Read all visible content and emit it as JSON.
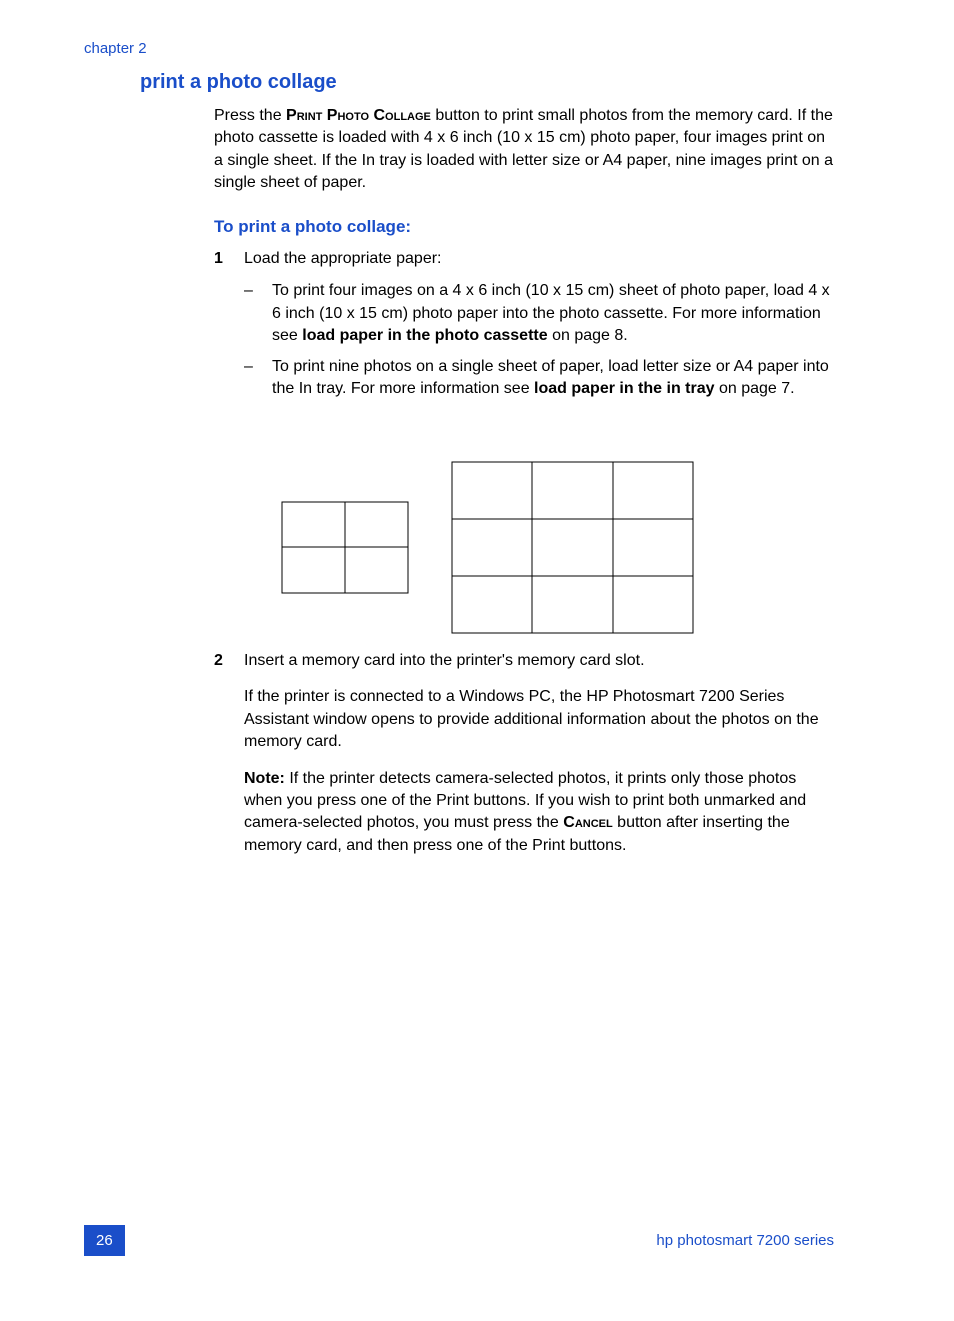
{
  "chapter": "chapter 2",
  "sectionTitle": "print a photo collage",
  "intro": {
    "pre": "Press the ",
    "btn": "Print Photo Collage",
    "post": " button to print small photos from the memory card. If the photo cassette is loaded with 4 x 6 inch (10 x 15 cm) photo paper, four images print on a single sheet. If the In tray is loaded with letter size or A4 paper, nine images print on a single sheet of paper."
  },
  "subheading": "To print a photo collage:",
  "step1": {
    "num": "1",
    "text": "Load the appropriate paper:",
    "bullet1": {
      "pre": "To print four images on a 4 x 6 inch (10 x 15 cm) sheet of photo paper, load 4 x 6 inch (10 x 15 cm) photo paper into the photo cassette. For more information see ",
      "bold": "load paper in the photo cassette",
      "post": " on page 8."
    },
    "bullet2": {
      "pre": "To print nine photos on a single sheet of paper, load letter size or A4 paper into the In tray. For more information see ",
      "bold": "load paper in the in tray",
      "post": " on page 7."
    }
  },
  "step2": {
    "num": "2",
    "text": "Insert a memory card into the printer's memory card slot.",
    "para2": "If the printer is connected to a Windows PC, the HP Photosmart 7200 Series Assistant window opens to provide additional information about the photos on the memory card.",
    "noteLabel": "Note:",
    "notePre": "  If the printer detects camera-selected photos, it prints only those photos when you press one of the Print buttons. If you wish to print both unmarked and camera-selected photos, you must press the ",
    "noteBtn": "Cancel",
    "notePost": " button after inserting the memory card, and then press one of the Print buttons."
  },
  "footer": {
    "page": "26",
    "text": "hp photosmart 7200 series"
  },
  "dash": "–"
}
